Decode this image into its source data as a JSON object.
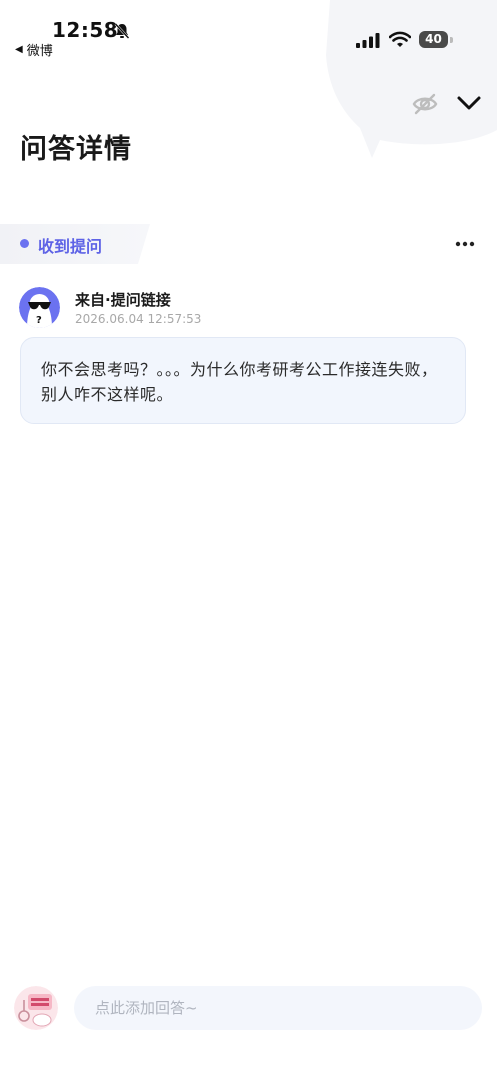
{
  "status_bar": {
    "time": "12:58",
    "back_app_label": "微博",
    "battery_level": "40"
  },
  "header": {
    "title": "问答详情",
    "icons": [
      "eye-off-icon",
      "chevron-down-icon"
    ]
  },
  "question_section": {
    "tag_label": "收到提问",
    "more_icon": "more-horizontal-icon",
    "sender": "来自·提问链接",
    "timestamp": "2026.06.04 12:57:53",
    "content": "你不会思考吗？。。。为什么你考研考公工作接连失败，别人咋不这样呢。"
  },
  "bottom_bar": {
    "answer_placeholder": "点此添加回答~"
  },
  "colors": {
    "accent": "#5e63e6",
    "bubble_bg": "#f2f6fd",
    "input_bg": "#f3f6fc"
  }
}
